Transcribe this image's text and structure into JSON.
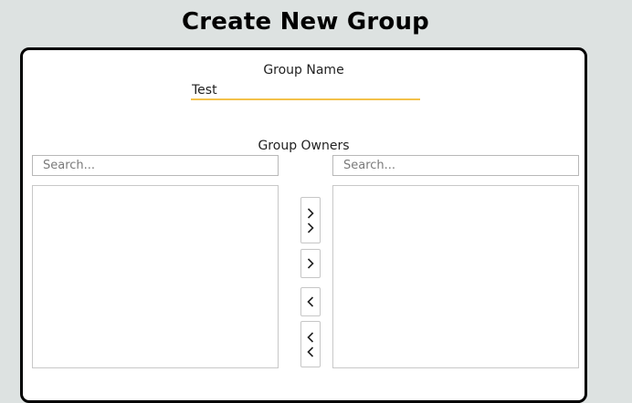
{
  "page": {
    "title": "Create New Group"
  },
  "form": {
    "group_name_label": "Group Name",
    "group_name_value": "Test",
    "group_owners_label": "Group Owners"
  },
  "owners": {
    "available_search_placeholder": "Search...",
    "selected_search_placeholder": "Search...",
    "available_items": [],
    "selected_items": []
  },
  "transfer_buttons": [
    {
      "name": "move-all-right",
      "icon": "double-chevron-right-icon"
    },
    {
      "name": "move-selected-right",
      "icon": "chevron-right-icon"
    },
    {
      "name": "move-selected-left",
      "icon": "chevron-left-icon"
    },
    {
      "name": "move-all-left",
      "icon": "double-chevron-left-icon"
    }
  ],
  "colors": {
    "page_background": "#dde2e1",
    "input_underline": "#f3c14a",
    "card_border": "#000000"
  }
}
